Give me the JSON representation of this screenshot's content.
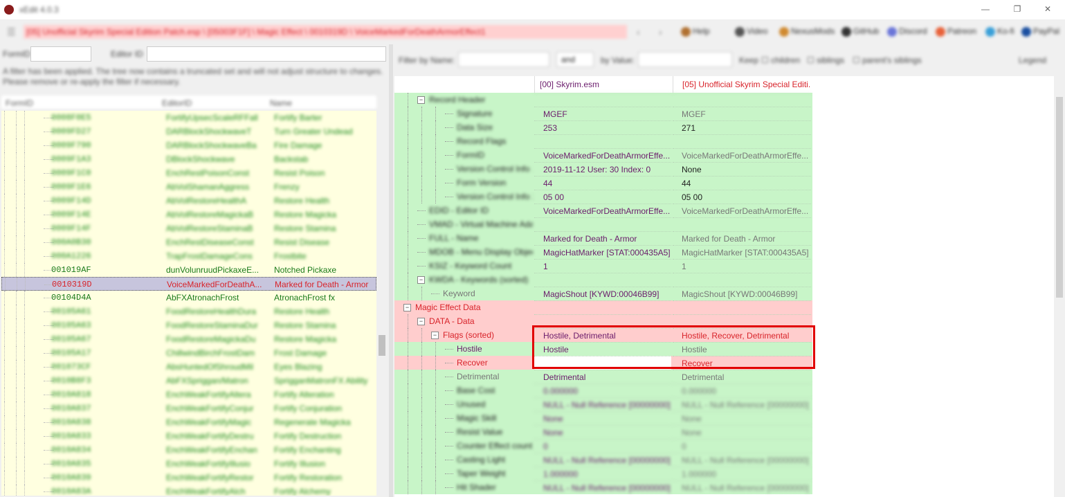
{
  "titlebar": {
    "title": "xEdit 4.0.3"
  },
  "toolbar": {
    "path": "[05] Unofficial Skyrim Special Edition Patch.esp \\ [05003F1F] \\ Magic Effect \\ 0010319D \\ VoiceMarkedForDeathArmorEffect1",
    "back": "‹",
    "forward": "›",
    "buttons": [
      {
        "label": "Help",
        "color": "#b07030"
      },
      {
        "label": "Video",
        "color": "#555555"
      },
      {
        "label": "NexusMods",
        "color": "#d08a30"
      },
      {
        "label": "GitHub",
        "color": "#333333"
      },
      {
        "label": "Discord",
        "color": "#6a75d8"
      },
      {
        "label": "Patreon",
        "color": "#e8623a"
      },
      {
        "label": "Ko-fi",
        "color": "#3aa0d8"
      },
      {
        "label": "PayPal",
        "color": "#1a4fa0"
      }
    ]
  },
  "left": {
    "formid_label": "FormID",
    "editorid_label": "Editor ID",
    "notice": "A filter has been applied. The tree now contains a truncated set and will not adjust structure to changes. Please remove or re-apply the filter if necessary.",
    "col_formid": "FormID",
    "col_editorid": "EditorID",
    "col_name": "Name",
    "rows": [
      {
        "formid": "0008F0E5",
        "editorid": "FortifyUpsecScaleRFFall",
        "name": "Fortify Barter",
        "state": "green"
      },
      {
        "formid": "0009FD27",
        "editorid": "DARBlockShockwaveT",
        "name": "Turn Greater Undead",
        "state": "green"
      },
      {
        "formid": "0009F790",
        "editorid": "DARBlockShockwaveBa",
        "name": "Fire Damage",
        "state": "green"
      },
      {
        "formid": "0009F1A3",
        "editorid": "DBlockShockwave",
        "name": "Backstab",
        "state": "green"
      },
      {
        "formid": "0009F1C0",
        "editorid": "EnchRestPoisonConst",
        "name": "Resist Poison",
        "state": "green"
      },
      {
        "formid": "0009F1E6",
        "editorid": "AbVolShamanAggress",
        "name": "Frenzy",
        "state": "green"
      },
      {
        "formid": "0009F14D",
        "editorid": "AbVolRestoreHealthA",
        "name": "Restore Health",
        "state": "green"
      },
      {
        "formid": "0009F14E",
        "editorid": "AbVolRestoreMagickaB",
        "name": "Restore Magicka",
        "state": "green"
      },
      {
        "formid": "0009F14F",
        "editorid": "AbVolRestoreStaminaB",
        "name": "Restore Stamina",
        "state": "green"
      },
      {
        "formid": "000A0B30",
        "editorid": "EnchRestDiseaseConst",
        "name": "Resist Disease",
        "state": "green"
      },
      {
        "formid": "000A1226",
        "editorid": "TrapFrostDamageCons",
        "name": "Frostbite",
        "state": "green"
      },
      {
        "formid": "001019AF",
        "editorid": "dunVolunruudPickaxeE...",
        "name": "Notched Pickaxe",
        "state": "sharp"
      },
      {
        "formid": "0010319D",
        "editorid": "VoiceMarkedForDeathA...",
        "name": "Marked for Death - Armor",
        "state": "sel"
      },
      {
        "formid": "00104D4A",
        "editorid": "AbFXAtronachFrost",
        "name": "AtronachFrost fx",
        "state": "sharp"
      },
      {
        "formid": "00105A61",
        "editorid": "FoodRestoreHealthDura",
        "name": "Restore Health",
        "state": "green"
      },
      {
        "formid": "00105A63",
        "editorid": "FoodRestoreStaminaDur",
        "name": "Restore Stamina",
        "state": "green"
      },
      {
        "formid": "00105A67",
        "editorid": "FoodRestoreMagickaDu",
        "name": "Restore Magicka",
        "state": "green"
      },
      {
        "formid": "00105A17",
        "editorid": "ChillwindBirchFrostDam",
        "name": "Frost Damage",
        "state": "green"
      },
      {
        "formid": "001073CF",
        "editorid": "AbsHuntedOfShroudMil",
        "name": "Eyes Blazing",
        "state": "green"
      },
      {
        "formid": "0010B8F3",
        "editorid": "AbFXSpriggan/Matron",
        "name": "SprigganMatronFX Ability",
        "state": "green"
      },
      {
        "formid": "0010A818",
        "editorid": "EnchWeakFortifyAltera",
        "name": "Fortify Alteration",
        "state": "green"
      },
      {
        "formid": "0010A837",
        "editorid": "EnchWeakFortifyConjur",
        "name": "Fortify Conjuration",
        "state": "green"
      },
      {
        "formid": "0010A838",
        "editorid": "EnchWeakFortifyMagic",
        "name": "Regenerate Magicka",
        "state": "green"
      },
      {
        "formid": "0010A833",
        "editorid": "EnchWeakFortifyDestru",
        "name": "Fortify Destruction",
        "state": "green"
      },
      {
        "formid": "0010A834",
        "editorid": "EnchWeakFortifyEnchan",
        "name": "Fortify Enchanting",
        "state": "green"
      },
      {
        "formid": "0010A835",
        "editorid": "EnchWeakFortifyIllusio",
        "name": "Fortify Illusion",
        "state": "green"
      },
      {
        "formid": "0010A839",
        "editorid": "EnchWeakFortifyRestor",
        "name": "Fortify Restoration",
        "state": "green"
      },
      {
        "formid": "0010A83A",
        "editorid": "EnchWeakFortifyAlch",
        "name": "Fortify Alchemy",
        "state": "green"
      }
    ]
  },
  "right": {
    "filter_name_label": "Filter by Name:",
    "filter_and": "and",
    "filter_value_label": "by Value:",
    "keep_label": "Keep",
    "keep_options": [
      "children",
      "siblings",
      "parent's siblings"
    ],
    "legend": "Legend",
    "header_master": "[00] Skyrim.esm",
    "header_plugin": "[05] Unofficial Skyrim Special Editi...",
    "rows": [
      {
        "name": "Record Header",
        "v1": "",
        "v2": "",
        "indent": 1,
        "exp": "−",
        "style": "gr",
        "blur": true
      },
      {
        "name": "Signature",
        "v1": "MGEF",
        "v2": "MGEF",
        "indent": 3,
        "style": "gr",
        "blur": "name"
      },
      {
        "name": "Data Size",
        "v1": "253",
        "v2": "271",
        "indent": 3,
        "style": "gr",
        "blur": "name",
        "v2sharp": true
      },
      {
        "name": "Record Flags",
        "v1": "",
        "v2": "",
        "indent": 3,
        "style": "gr",
        "blur": "name"
      },
      {
        "name": "FormID",
        "v1": "VoiceMarkedForDeathArmorEffe...",
        "v2": "VoiceMarkedForDeathArmorEffe...",
        "indent": 3,
        "style": "gr",
        "blur": "name"
      },
      {
        "name": "Version Control Info 1",
        "v1": "2019-11-12 User: 30 Index: 0",
        "v2": "None",
        "indent": 3,
        "style": "gr",
        "blur": "name",
        "v2sharp": true
      },
      {
        "name": "Form Version",
        "v1": "44",
        "v2": "44",
        "indent": 3,
        "style": "gr",
        "blur": "name",
        "v2sharp": true
      },
      {
        "name": "Version Control Info 2",
        "v1": "05 00",
        "v2": "05 00",
        "indent": 3,
        "style": "gr",
        "blur": "name",
        "v2sharp": true
      },
      {
        "name": "EDID - Editor ID",
        "v1": "VoiceMarkedForDeathArmorEffe...",
        "v2": "VoiceMarkedForDeathArmorEffe...",
        "indent": 1,
        "style": "gr",
        "blur": "name"
      },
      {
        "name": "VMAD - Virtual Machine Ada",
        "v1": "",
        "v2": "",
        "indent": 1,
        "style": "gr",
        "blur": "name"
      },
      {
        "name": "FULL - Name",
        "v1": "Marked for Death - Armor",
        "v2": "Marked for Death - Armor",
        "indent": 1,
        "style": "gr",
        "blur": "name"
      },
      {
        "name": "MDOB - Menu Display Object",
        "v1": "MagicHatMarker [STAT:000435A5]",
        "v2": "MagicHatMarker [STAT:000435A5]",
        "indent": 1,
        "style": "gr",
        "blur": "name"
      },
      {
        "name": "KSIZ - Keyword Count",
        "v1": "1",
        "v2": "1",
        "indent": 1,
        "style": "gr",
        "blur": "name"
      },
      {
        "name": "KWDA - Keywords (sorted)",
        "v1": "",
        "v2": "",
        "indent": 1,
        "exp": "−",
        "style": "gr",
        "blur": "name"
      },
      {
        "name": "Keyword",
        "v1": "MagicShout [KYWD:00046B99]",
        "v2": "MagicShout [KYWD:00046B99]",
        "indent": 2,
        "style": "gr",
        "namegray": true
      },
      {
        "name": "Magic Effect Data",
        "v1": "",
        "v2": "",
        "indent": 0,
        "exp": "−",
        "style": "rd"
      },
      {
        "name": "DATA - Data",
        "v1": "",
        "v2": "",
        "indent": 1,
        "exp": "−",
        "style": "rd"
      },
      {
        "name": "Flags (sorted)",
        "v1": "Hostile, Detrimental",
        "v2": "Hostile, Recover, Detrimental",
        "indent": 2,
        "exp": "−",
        "style": "rd",
        "v1purple": true
      },
      {
        "name": "Hostile",
        "v1": "Hostile",
        "v2": "Hostile",
        "indent": 3,
        "style": "gr",
        "namepurple": true
      },
      {
        "name": "Recover",
        "v1": "",
        "v2": "Recover",
        "indent": 3,
        "style": "rd",
        "v1white": true,
        "v2red": true
      },
      {
        "name": "Detrimental",
        "v1": "Detrimental",
        "v2": "Detrimental",
        "indent": 3,
        "style": "gr",
        "namegray": true
      },
      {
        "name": "Base Cost",
        "v1": "0.000000",
        "v2": "0.000000",
        "indent": 3,
        "style": "gr",
        "blur": true
      },
      {
        "name": "Unused",
        "v1": "NULL - Null Reference [00000000]",
        "v2": "NULL - Null Reference [00000000]",
        "indent": 3,
        "style": "gr",
        "blur": true
      },
      {
        "name": "Magic Skill",
        "v1": "None",
        "v2": "None",
        "indent": 3,
        "style": "gr",
        "blur": true
      },
      {
        "name": "Resist Value",
        "v1": "None",
        "v2": "None",
        "indent": 3,
        "style": "gr",
        "blur": true
      },
      {
        "name": "Counter Effect count",
        "v1": "0",
        "v2": "0",
        "indent": 3,
        "style": "gr",
        "blur": true
      },
      {
        "name": "Casting Light",
        "v1": "NULL - Null Reference [00000000]",
        "v2": "NULL - Null Reference [00000000]",
        "indent": 3,
        "style": "gr",
        "blur": true
      },
      {
        "name": "Taper Weight",
        "v1": "1.000000",
        "v2": "1.000000",
        "indent": 3,
        "style": "gr",
        "blur": true
      },
      {
        "name": "Hit Shader",
        "v1": "NULL - Null Reference [00000000]",
        "v2": "NULL - Null Reference [00000000]",
        "indent": 3,
        "style": "gr",
        "blur": true
      }
    ]
  },
  "colors": {
    "accent_red": "#d8232a",
    "master_purple": "#6a1b6b",
    "row_green": "#c8f5c8",
    "row_red": "#ffcdcd",
    "highlight": "#e10000"
  }
}
